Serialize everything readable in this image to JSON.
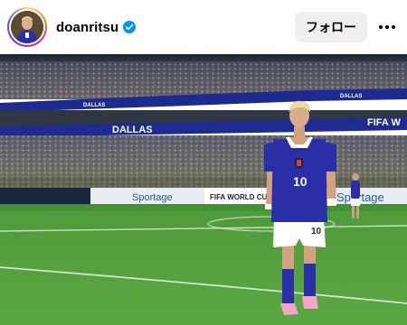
{
  "post": {
    "username": "doanritsu",
    "verified": true,
    "follow_label": "フォロー",
    "avatar_icon": "profile-avatar",
    "more_icon": "more-options-icon"
  },
  "photo": {
    "ribbon_text_1": "DALLAS",
    "ribbon_text_2": "DALLAS",
    "ribbon_text_3": "FIFA W",
    "ribbon_text_4": "DALLAS",
    "board_text_1": "Sportage",
    "board_text_2": "FIFA WORLD CUP",
    "board_text_3": "Sportage",
    "jersey_number": "10",
    "shorts_number": "10"
  },
  "colors": {
    "accent_blue": "#0095f6",
    "jersey": "#2a2fa8",
    "pitch": "#4e9b3a"
  }
}
